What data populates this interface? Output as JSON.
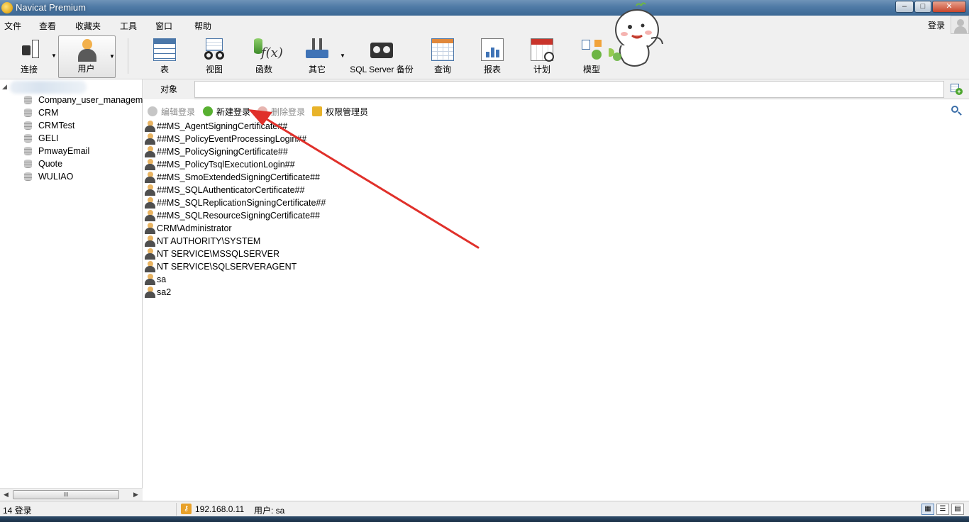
{
  "window": {
    "title": "Navicat Premium"
  },
  "menu": {
    "items": [
      "文件",
      "查看",
      "收藏夹",
      "工具",
      "窗口",
      "帮助"
    ],
    "login": "登录"
  },
  "toolbar": {
    "connect": "连接",
    "user": "用户",
    "table": "表",
    "view": "视图",
    "function": "函数",
    "other": "其它",
    "backup": "SQL Server 备份",
    "query": "查询",
    "report": "报表",
    "schedule": "计划",
    "model": "模型"
  },
  "sidebar": {
    "databases": [
      "Company_user_managem",
      "CRM",
      "CRMTest",
      "GELI",
      "PmwayEmail",
      "Quote",
      "WULIAO"
    ],
    "scroll_thumb": "III"
  },
  "tabs": {
    "objects": "对象"
  },
  "object_toolbar": {
    "edit": "编辑登录",
    "new": "新建登录",
    "delete": "删除登录",
    "roles": "权限管理员"
  },
  "logins": [
    "##MS_AgentSigningCertificate##",
    "##MS_PolicyEventProcessingLogin##",
    "##MS_PolicySigningCertificate##",
    "##MS_PolicyTsqlExecutionLogin##",
    "##MS_SmoExtendedSigningCertificate##",
    "##MS_SQLAuthenticatorCertificate##",
    "##MS_SQLReplicationSigningCertificate##",
    "##MS_SQLResourceSigningCertificate##",
    "CRM\\Administrator",
    "NT AUTHORITY\\SYSTEM",
    "NT SERVICE\\MSSQLSERVER",
    "NT SERVICE\\SQLSERVERAGENT",
    "sa",
    "sa2"
  ],
  "status": {
    "count": "14 登录",
    "ip": "192.168.0.11",
    "user": "用户: sa"
  },
  "colors": {
    "annotation_arrow": "#e0302a",
    "titlebar": "#4f7aa6"
  }
}
